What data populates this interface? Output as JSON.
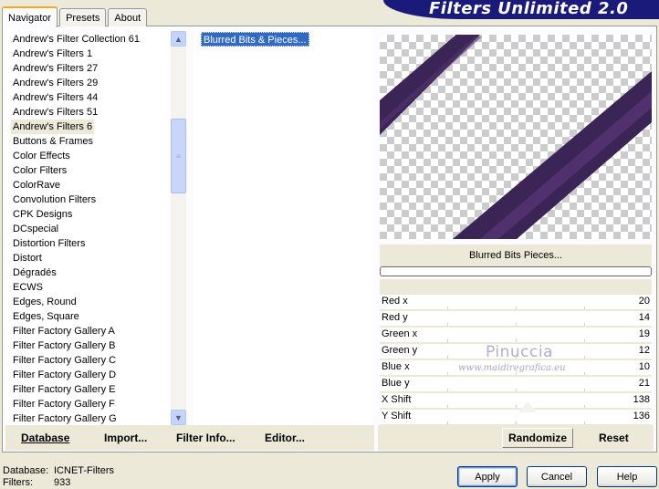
{
  "banner": {
    "title": "Filters Unlimited 2.0"
  },
  "tabs": [
    {
      "label": "Navigator",
      "active": true
    },
    {
      "label": "Presets",
      "active": false
    },
    {
      "label": "About",
      "active": false
    }
  ],
  "categories": {
    "selected_index": 6,
    "items": [
      "Andrew's Filter Collection 61",
      "Andrew's Filters 1",
      "Andrew's Filters 27",
      "Andrew's Filters 29",
      "Andrew's Filters 44",
      "Andrew's Filters 51",
      "Andrew's Filters 6",
      "Buttons & Frames",
      "Color Effects",
      "Color Filters",
      "ColorRave",
      "Convolution Filters",
      "CPK Designs",
      "DCspecial",
      "Distortion Filters",
      "Distort",
      "Dégradés",
      "ECWS",
      "Edges, Round",
      "Edges, Square",
      "Filter Factory Gallery A",
      "Filter Factory Gallery B",
      "Filter Factory Gallery C",
      "Filter Factory Gallery D",
      "Filter Factory Gallery E",
      "Filter Factory Gallery F",
      "Filter Factory Gallery G"
    ]
  },
  "filters": {
    "selected": "Blurred Bits & Pieces..."
  },
  "preview": {
    "effect_label": "Blurred Bits  Pieces..."
  },
  "params": [
    {
      "label": "Red x",
      "value": "20"
    },
    {
      "label": "Red y",
      "value": "14"
    },
    {
      "label": "Green x",
      "value": "19"
    },
    {
      "label": "Green y",
      "value": "12"
    },
    {
      "label": "Blue x",
      "value": "10"
    },
    {
      "label": "Blue y",
      "value": "21"
    },
    {
      "label": "X Shift",
      "value": "138"
    },
    {
      "label": "Y Shift",
      "value": "136"
    }
  ],
  "watermark": {
    "name": "Pinuccia",
    "url": "www.maidiregrafica.eu"
  },
  "actions": {
    "database": "Database",
    "import": "Import...",
    "filter_info": "Filter Info...",
    "editor": "Editor...",
    "randomize": "Randomize",
    "reset": "Reset"
  },
  "footer": {
    "database_label": "Database:",
    "database_value": "ICNET-Filters",
    "filters_label": "Filters:",
    "filters_value": "933"
  },
  "dialog_buttons": {
    "apply": "Apply",
    "cancel": "Cancel",
    "help": "Help"
  },
  "colors": {
    "banner": "#1a1a7a",
    "selection": "#316ac5",
    "stripe": "#3b2456"
  },
  "icons": {
    "scroll_up": "triangle-up",
    "scroll_down": "triangle-down",
    "thumb_grip": "grip-lines"
  }
}
